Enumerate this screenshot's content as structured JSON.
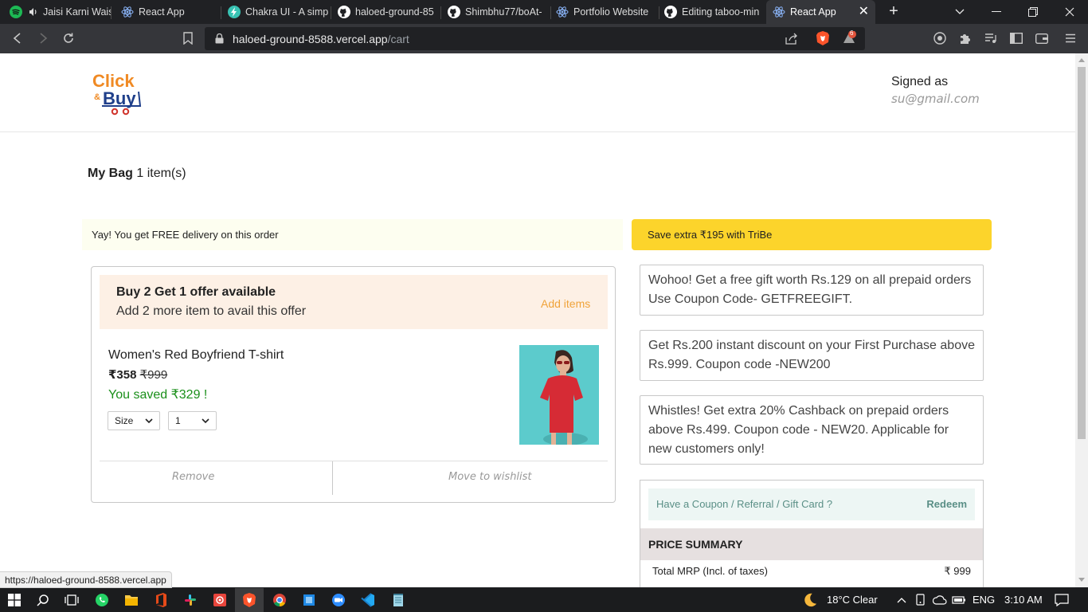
{
  "browser": {
    "tabs": [
      {
        "label": "Jaisi Karni Wais",
        "icon": "spotify-icon"
      },
      {
        "label": "React App",
        "icon": "react-icon"
      },
      {
        "label": "Chakra UI - A simp",
        "icon": "chakra-icon"
      },
      {
        "label": "haloed-ground-85",
        "icon": "github-icon"
      },
      {
        "label": "Shimbhu77/boAt-",
        "icon": "github-icon"
      },
      {
        "label": "Portfolio Website",
        "icon": "react-icon"
      },
      {
        "label": "Editing taboo-min",
        "icon": "github-icon"
      },
      {
        "label": "React App",
        "icon": "react-icon"
      }
    ],
    "url_host": "haloed-ground-8588.vercel.app",
    "url_path": "/cart",
    "brave_badge": "6",
    "status_url": "https://haloed-ground-8588.vercel.app"
  },
  "header": {
    "logo_text_top": "Click",
    "logo_text_amp": "&",
    "logo_text_bottom": "Buy",
    "signed_as_label": "Signed as",
    "signed_email": "su@gmail.com"
  },
  "bag": {
    "title": "My Bag",
    "count": "1 item(s)"
  },
  "banners": {
    "free_delivery": "Yay! You get FREE delivery on this order",
    "tribe": "Save extra ₹195 with TriBe"
  },
  "cart_item": {
    "offer_title": "Buy 2 Get 1 offer available",
    "offer_sub": "Add 2 more item to avail this offer",
    "offer_action": "Add items",
    "name": "Women's Red Boyfriend T-shirt",
    "price": "₹358",
    "mrp": "₹999",
    "saved": "You saved ₹329 !",
    "size_label": "Size",
    "qty_value": "1",
    "remove": "Remove",
    "wishlist": "Move to wishlist"
  },
  "coupons": [
    "Wohoo! Get a free gift worth Rs.129 on all prepaid orders Use Coupon Code- GETFREEGIFT.",
    "Get Rs.200 instant discount on your First Purchase above Rs.999. Coupon code -NEW200",
    "Whistles! Get extra 20% Cashback on prepaid orders above Rs.499. Coupon code - NEW20. Applicable for new customers only!"
  ],
  "summary": {
    "coupon_question": "Have a Coupon / Referral / Gift Card ?",
    "redeem": "Redeem",
    "heading": "PRICE SUMMARY",
    "mrp_label": "Total MRP (Incl. of taxes)",
    "mrp_value": "₹ 999"
  },
  "taskbar": {
    "weather": "18°C  Clear",
    "language": "ENG",
    "time": "3:10 AM"
  },
  "colors": {
    "accent_orange": "#f0a33a",
    "tribe_yellow": "#fcd42b",
    "saved_green": "#1a8f1a"
  }
}
